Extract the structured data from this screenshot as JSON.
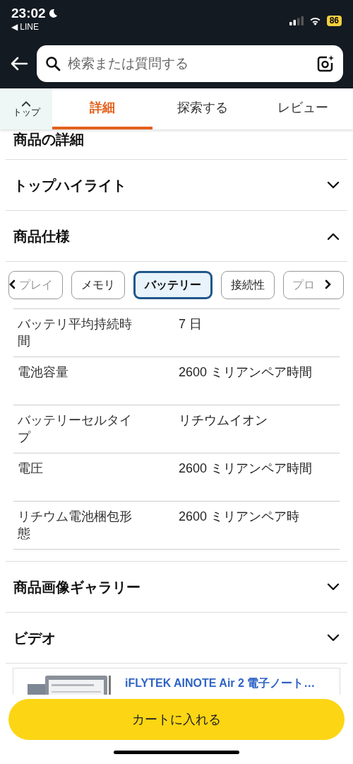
{
  "status_bar": {
    "time": "23:02",
    "back_app": "◀ LINE",
    "battery": "86"
  },
  "search": {
    "placeholder": "検索または質問する"
  },
  "tabs": [
    {
      "label": "トップ",
      "kind": "top",
      "selected": false
    },
    {
      "label": "詳細",
      "kind": "tab",
      "selected": true
    },
    {
      "label": "探索する",
      "kind": "tab",
      "selected": false
    },
    {
      "label": "レビュー",
      "kind": "tab",
      "selected": false
    }
  ],
  "heading": "商品の詳細",
  "sections": [
    {
      "title": "トップハイライト",
      "expanded": false
    },
    {
      "title": "商品仕様",
      "expanded": true,
      "chips": [
        {
          "label": "プレイ",
          "selected": false
        },
        {
          "label": "メモリ",
          "selected": false
        },
        {
          "label": "バッテリー",
          "selected": true
        },
        {
          "label": "接続性",
          "selected": false
        },
        {
          "label": "プロ",
          "selected": false
        }
      ],
      "specs": [
        {
          "name": "バッテリ平均持続時間",
          "value": "7 日"
        },
        {
          "name": "電池容量",
          "value": "2600 ミリアンペア時間"
        },
        {
          "name": "バッテリーセルタイプ",
          "value": "リチウムイオン"
        },
        {
          "name": "電圧",
          "value": "2600 ミリアンペア時間"
        },
        {
          "name": "リチウム電池梱包形態",
          "value": "2600 ミリアンペア時"
        }
      ]
    },
    {
      "title": "商品画像ギャラリー",
      "expanded": false
    },
    {
      "title": "ビデオ",
      "expanded": false
    }
  ],
  "product": {
    "kind": "picture",
    "title": "iFLYTEK AINOTE Air 2 電子ノート…"
  },
  "cart_button": "カートに入れる"
}
